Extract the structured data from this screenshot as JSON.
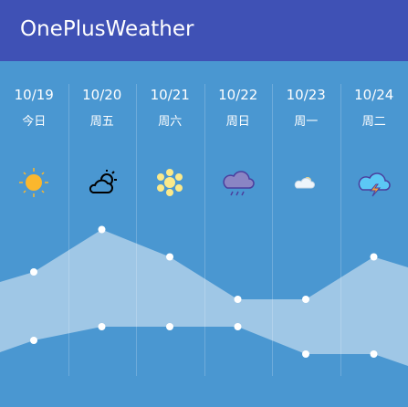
{
  "app": {
    "title": "OnePlusWeather"
  },
  "days": [
    {
      "date": "10/19",
      "weekday": "今日",
      "icon": "sunny-icon"
    },
    {
      "date": "10/20",
      "weekday": "周五",
      "icon": "partly-cloudy-icon"
    },
    {
      "date": "10/21",
      "weekday": "周六",
      "icon": "snow-icon"
    },
    {
      "date": "10/22",
      "weekday": "周日",
      "icon": "rain-cloud-icon"
    },
    {
      "date": "10/23",
      "weekday": "周一",
      "icon": "cloudy-icon"
    },
    {
      "date": "10/24",
      "weekday": "周二",
      "icon": "thunderstorm-icon"
    }
  ],
  "colors": {
    "appbar": "#3f51b5",
    "background": "#4a97d1",
    "band": "#9fc7e6",
    "point": "#ffffff"
  },
  "chart_data": {
    "type": "area",
    "note_levels": "relative temperature levels, no values printed",
    "high": [
      6.8,
      9.9,
      7.9,
      4.8,
      4.8,
      7.9
    ],
    "low": [
      1.8,
      2.8,
      2.8,
      2.8,
      0.8,
      0.8
    ]
  }
}
